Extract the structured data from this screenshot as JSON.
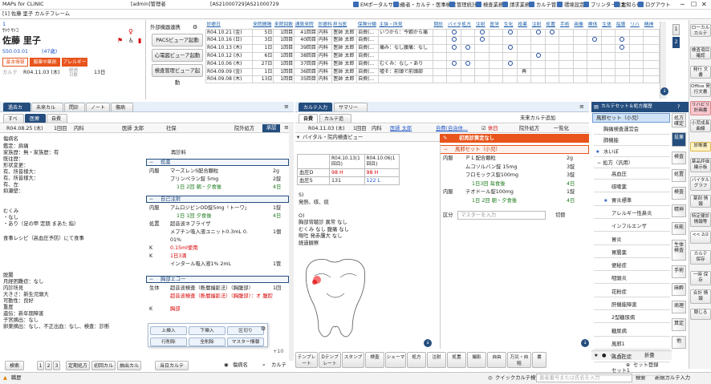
{
  "title_bar": {
    "app": "MAPs for CLINIC",
    "patient_title": "[1] 佐藤 里子 カルテフレーム",
    "user": "[admin]管理者",
    "device": "[AS21000729]AS21000729",
    "links": [
      "EMポータルサイト",
      "患者・カルテ・医事検索",
      "管理統計",
      "検査業務",
      "請求業務",
      "カルテ管理",
      "環境設定",
      "プリンター設定",
      "お知らせ",
      "ログアウト"
    ]
  },
  "patient": {
    "id": "1",
    "kana": "ｻﾄｳ ｻﾄｺ",
    "name": "佐藤 里子",
    "birth": "S50.03.01",
    "age": "(47歳)",
    "tags": [
      "基本情報",
      "服薬中薬剤",
      "アレルギー"
    ],
    "karte_label": "カルテ",
    "karte_date": "R04.11.03 (木)",
    "elapsed_label": "経過日数",
    "elapsed": "13日"
  },
  "order_buttons": {
    "group": "外部機器連携",
    "pacs": "PACSビューア起動",
    "ecg": "心電図ビューア起動",
    "lab": "検査管理ビューア起動"
  },
  "history": {
    "headers": [
      "診療日",
      "来院間隔",
      "来院回数",
      "通算来院",
      "診療科",
      "担当医",
      "保険分類",
      "主訴・所見",
      "問診",
      "バイタル",
      "処方",
      "注射",
      "医学",
      "生化",
      "投薬",
      "注射",
      "処置",
      "手術",
      "画像",
      "検体",
      "生体",
      "指導",
      "リハ",
      "精神"
    ],
    "rows": [
      {
        "date": "R04.10.21 (金)",
        "int": "5日",
        "cnt": "1回目",
        "total": "41回目",
        "dept": "内科",
        "doc": "医師 太郎",
        "ins": "自費(...",
        "cc": "いつから：今朝から痛",
        "marks": [
          0,
          1,
          0,
          1,
          0,
          1,
          0,
          1,
          1,
          0,
          0,
          0,
          0,
          0,
          0,
          0
        ]
      },
      {
        "date": "R04.10.16 (日)",
        "int": "3日",
        "cnt": "1回目",
        "total": "40回目",
        "dept": "内科",
        "doc": "医師 太郎",
        "ins": "自費(...",
        "cc": "",
        "marks": [
          0,
          1,
          0,
          1,
          0,
          0,
          0,
          0,
          0,
          0,
          0,
          1,
          0,
          1,
          0,
          0
        ]
      },
      {
        "date": "R04.10.13 (木)",
        "int": "1日",
        "cnt": "1回目",
        "total": "39回目",
        "dept": "内科",
        "doc": "医師 太郎",
        "ins": "自費(...",
        "cc": "痛み：なし腹痛：なし",
        "marks": [
          0,
          1,
          1,
          0,
          0,
          1,
          0,
          0,
          0,
          0,
          0,
          0,
          0,
          1,
          0,
          0
        ]
      },
      {
        "date": "R04.10.12 (水)",
        "int": "6日",
        "cnt": "1回目",
        "total": "38回目",
        "dept": "内科",
        "doc": "医師 太郎",
        "ins": "自費(...",
        "cc": "",
        "marks": [
          0,
          0,
          0,
          0,
          0,
          0,
          0,
          1,
          0,
          0,
          0,
          0,
          0,
          0,
          0,
          0
        ]
      },
      {
        "date": "R04.10.06 (木)",
        "int": "27日",
        "cnt": "1回目",
        "total": "37回目",
        "dept": "内科",
        "doc": "医師 太郎",
        "ins": "自費(...",
        "cc": "むくみ：なし・あり",
        "marks": [
          0,
          1,
          1,
          0,
          0,
          1,
          0,
          0,
          0,
          0,
          0,
          0,
          0,
          0,
          0,
          0
        ]
      },
      {
        "date": "R04.09.09 (金)",
        "int": "1日",
        "cnt": "1回目",
        "total": "36回目",
        "dept": "内科",
        "doc": "医師 太郎",
        "ins": "自費(...",
        "cc": "嘘そ：前頭で前頭部",
        "marks": [
          0,
          0,
          0,
          0,
          0,
          0,
          0,
          0,
          0,
          0,
          0,
          0,
          0,
          0,
          0,
          0
        ]
      },
      {
        "date": "R04.09.08 (木)",
        "int": "13日",
        "cnt": "1回目",
        "total": "35回目",
        "dept": "内科",
        "doc": "医師 太郎",
        "ins": "自費(...",
        "cc": "",
        "marks": [
          0,
          0,
          0,
          0,
          0,
          0,
          0,
          0,
          0,
          0,
          0,
          0,
          0,
          0,
          0,
          0
        ]
      }
    ],
    "extra_mark": "再"
  },
  "right_nav": [
    "ローカル カルテ",
    "検査項目 確認",
    "発行 文書",
    "Office 発行文書",
    "リハビリ 計画書",
    "小児成長曲線",
    "診断書",
    "薬品評価 撮示板",
    "バイタル グラフ",
    "薬剤 情報",
    "特定健診 情報等",
    "<< 2/2",
    "カルテ 保存",
    "一時 保存",
    "合計 情報",
    "閉じる"
  ],
  "left_tabs": [
    "過去カルテ",
    "未来カルテ",
    "問診",
    "ノート",
    "傷病"
  ],
  "left_subtabs": [
    "すべて",
    "医療",
    "自費"
  ],
  "left_header": {
    "date": "R04.08.25 (木)",
    "visit": "1回目",
    "dept": "内科",
    "doc": "医師 太郎",
    "ins": "社保",
    "rx": "院外処方",
    "approve": "承認"
  },
  "left_text": [
    "傷病名",
    "鑑定：肩痛",
    "家族歴：無・家族歴：有",
    "既往歴：",
    "形状変更：",
    "有、所皆様大：",
    "有、所皆様大：",
    "有、左",
    "抑瀬壁：",
    "むくみ",
    "・なし",
    "・あり（足の甲 定期 まあた 指）",
    "食事レシピ（高血圧予防）にて食事",
    "脱腸",
    "月経困難症：なし",
    "内診所見",
    "大きさ：新生児頭大",
    "可動性：良好",
    "重度",
    "遺伝：新年期障害",
    "子宮摘出：なし",
    "卵巣摘出：なし、不正出血：なし、検査：診断"
  ],
  "left_right_panel": {
    "dept_title": "再診料",
    "sec1": "投薬",
    "sec2": "自己注射",
    "sec3": "胸部エコー",
    "rx1": [
      {
        "label": "内服",
        "name": "マーズレンS配合顆粒",
        "qty": "2g"
      },
      {
        "label": "",
        "name": "プリンペラン錠 5mg",
        "qty": "2錠"
      },
      {
        "label": "",
        "name": "1日 2回 朝・夕食後",
        "qty": "4日",
        "green": true
      }
    ],
    "rx2": [
      {
        "label": "内服",
        "name": "アムロジピンOD錠5mg「トーワ」",
        "qty": "1錠"
      },
      {
        "label": "",
        "name": "1日 1回 夕食後",
        "qty": "4日",
        "green": true
      },
      {
        "label": "処置",
        "name": "超音波ネブライザ",
        "qty": ""
      },
      {
        "label": "",
        "name": "メプチン吸入液ユニット0.3mL 0.",
        "qty": "1個"
      },
      {
        "label": "",
        "name": "01%",
        "qty": ""
      },
      {
        "label": "K",
        "name": "0.15ml使用",
        "qty": "",
        "red": true
      },
      {
        "label": "K",
        "name": "1日3滴",
        "qty": "",
        "red": true
      },
      {
        "label": "",
        "name": "インタール吸入液1% 2mL",
        "qty": "1管"
      }
    ],
    "rx3": [
      {
        "label": "生体",
        "name": "超音波検査（断層撮影法）（胸腹部）",
        "qty": "1回"
      },
      {
        "label": "",
        "name": "超音波検査（断層撮影法）（胸腹部）：オ 腹腔内・血管内の対策対応",
        "qty": "",
        "red": true
      },
      {
        "label": "K",
        "name": "胸部",
        "qty": "",
        "red": true
      }
    ],
    "popup": [
      "上挿入",
      "下挿入",
      "区切り",
      "行削除",
      "全削除",
      "マスター情報"
    ],
    "plus10": "+10"
  },
  "left_bottom": {
    "search": "検索",
    "pages": [
      "1",
      "2",
      "3"
    ],
    "buttons": [
      "定期処方",
      "初回カルテ",
      "抽出カルテ",
      "当日カルテ"
    ],
    "disease": "傷病名",
    "karte": "カルテ"
  },
  "mid": {
    "tabs": [
      "カルテ入力",
      "サマリー"
    ],
    "subtabs": [
      "自費",
      "カルテ追加"
    ],
    "future": "未来カルテ追加",
    "header": {
      "date": "R04.11.03 (木)",
      "visit": "1回目",
      "dept": "内科",
      "doc": "医師 太郎",
      "ins": "自費(自治体...",
      "holiday": "休日",
      "rx": "院外処方",
      "simple": "一覧化"
    },
    "vital_title": "バイタル・院内検査ビュー",
    "vital": {
      "cols": [
        "R04.10.13(1回目)",
        "R04.10.06(1回目)"
      ],
      "rows": [
        {
          "name": "血圧D",
          "v1": "98 H",
          "v2": "98 H",
          "red": true
        },
        {
          "name": "血圧S",
          "v1": "131",
          "v2": "122 L",
          "blue2": true
        }
      ]
    },
    "soap": [
      "S)",
      "発熱、咳、痰",
      "",
      "O)",
      "胸部背聴診 異常 なし",
      "むくみ なし 腹痛 なし",
      "嘔吐 発赤腫大 なし",
      "経過観察"
    ],
    "bottom": [
      "テンプレート",
      "Dテンプレート",
      "スタンプ",
      "検査",
      "シェーマ",
      "処方",
      "注射",
      "処置",
      "撮影",
      "自由",
      "万災・自賠",
      "書"
    ],
    "disease_bar": "初再診算定なし",
    "rx_title": "風邪セット（小児）",
    "rx": [
      {
        "label": "内服",
        "name": "ＰＬ配合顆粒",
        "qty": "2g"
      },
      {
        "label": "",
        "name": "ムコソルバン錠 15mg",
        "qty": "3錠"
      },
      {
        "label": "",
        "name": "フロモックス錠100mg",
        "qty": "3錠"
      },
      {
        "label": "",
        "name": "1日3回 毎食後",
        "qty": "4日",
        "green": true
      },
      {
        "label": "内服",
        "name": "テオドール錠100mg",
        "qty": "1錠"
      },
      {
        "label": "",
        "name": "1日 2回 朝・夕食後",
        "qty": "4日",
        "green": true
      }
    ],
    "section_label": "区分",
    "master": "マスターを入力",
    "pin": "切替"
  },
  "set_panel": {
    "title": "カルテセット＆処方履歴",
    "selected": "風邪セット（小児）",
    "items": [
      "胸痛検査運営会",
      "肺機能",
      "水いぼ"
    ],
    "group": "処方（汎用）",
    "group_items": [
      "高血圧",
      "咳嗽薬",
      "胃炎標準",
      "アレルギー性鼻炎",
      "インフルエンザ",
      "胃炎",
      "胃腸薬",
      "便秘症",
      "咽頭炎",
      "花粉症",
      "肝機能障害",
      "2型糖尿病",
      "糖尿病",
      "風邪1",
      "高血圧症",
      "セット1"
    ],
    "side": [
      "処方確定",
      "投薬",
      "検査",
      "処置",
      "検査",
      "精神",
      "技能",
      "生体検査",
      "手術",
      "麻酔",
      "病理",
      "算定",
      "他"
    ],
    "bottom": {
      "search": "検索",
      "new": "新規カルテ入力",
      "cand": "セット登録",
      "pages": "折畳"
    }
  },
  "status": {
    "left": "職歴",
    "qsearch": "クイックカルテ検索",
    "qplaceholder": "患者番号または氏名を入力"
  }
}
